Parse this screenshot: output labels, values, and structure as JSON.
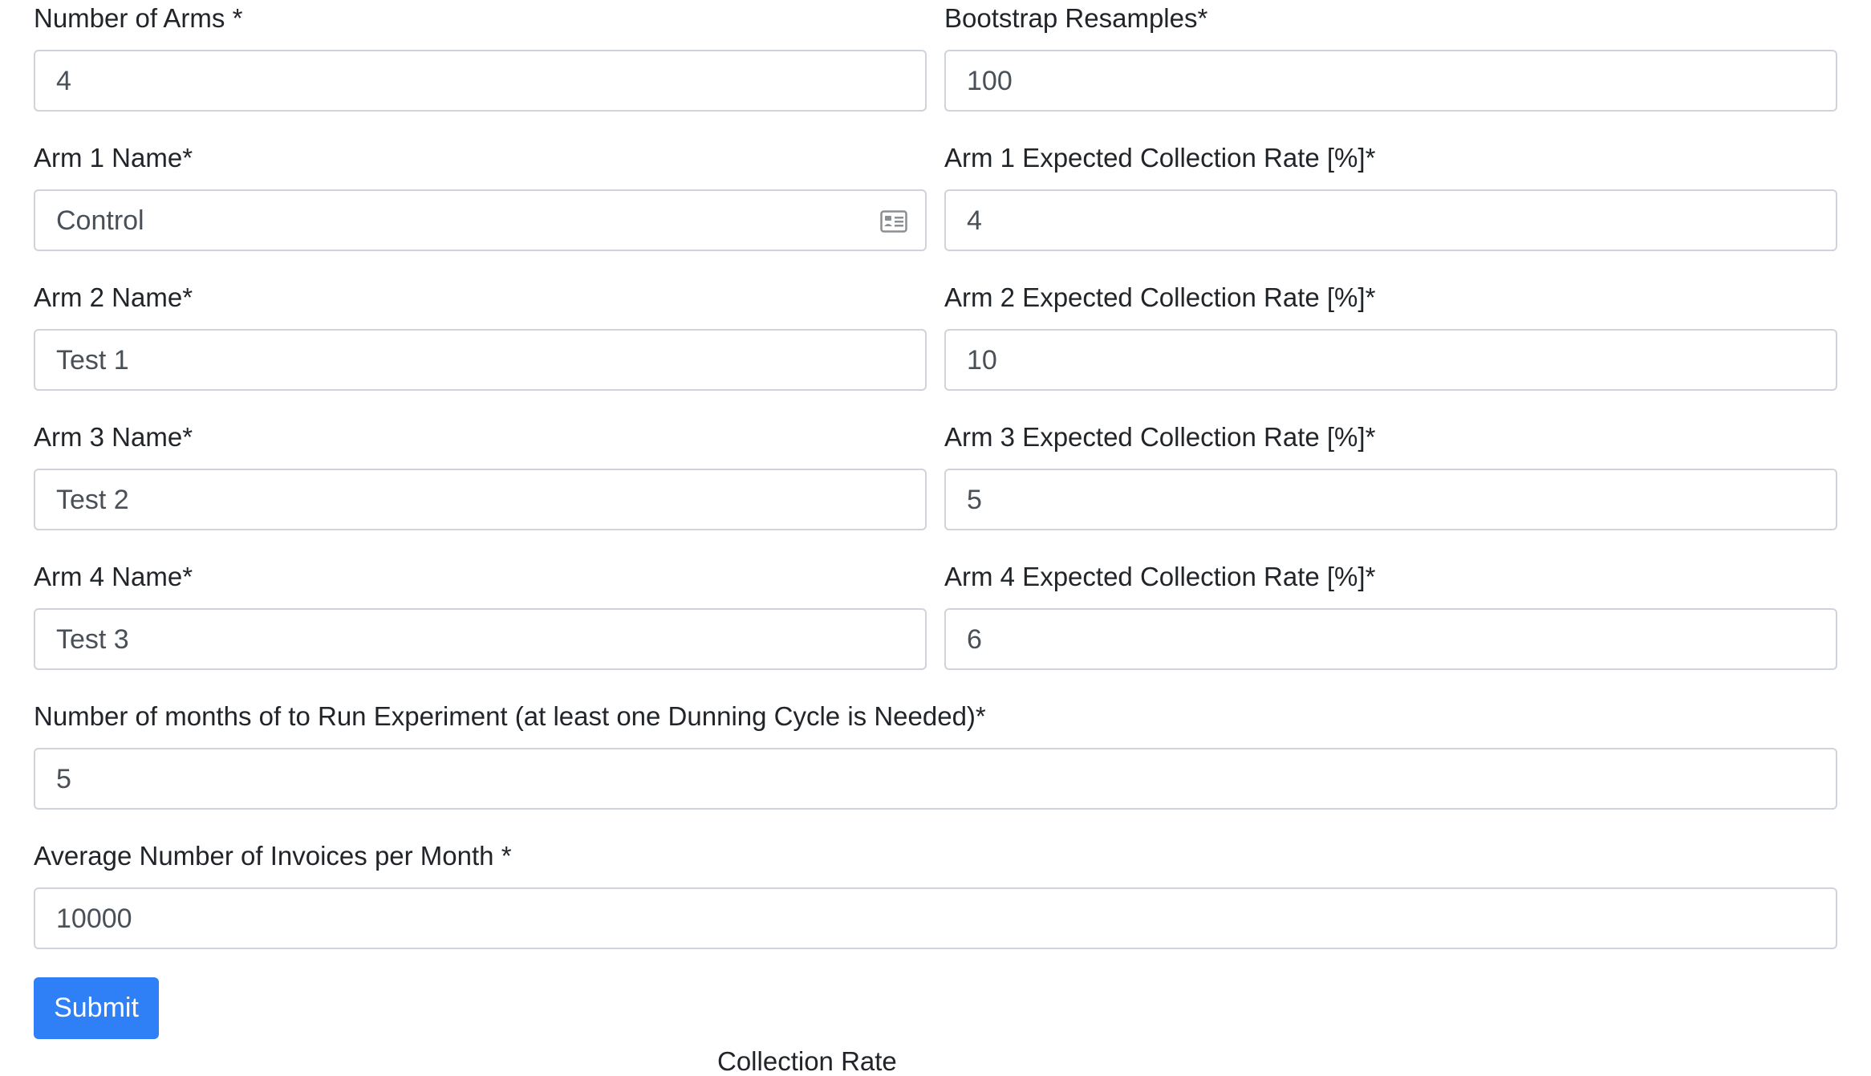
{
  "form": {
    "num_arms": {
      "label": "Number of Arms *",
      "value": "4"
    },
    "bootstrap": {
      "label": "Bootstrap Resamples*",
      "value": "100"
    },
    "arms": [
      {
        "name_label": "Arm 1 Name*",
        "name_value": "Control",
        "rate_label": "Arm 1 Expected Collection Rate [%]*",
        "rate_value": "4"
      },
      {
        "name_label": "Arm 2 Name*",
        "name_value": "Test 1",
        "rate_label": "Arm 2 Expected Collection Rate [%]*",
        "rate_value": "10"
      },
      {
        "name_label": "Arm 3 Name*",
        "name_value": "Test 2",
        "rate_label": "Arm 3 Expected Collection Rate [%]*",
        "rate_value": "5"
      },
      {
        "name_label": "Arm 4 Name*",
        "name_value": "Test 3",
        "rate_label": "Arm 4 Expected Collection Rate [%]*",
        "rate_value": "6"
      }
    ],
    "months": {
      "label": "Number of months of to Run Experiment (at least one Dunning Cycle is Needed)*",
      "value": "5"
    },
    "invoices": {
      "label": "Average Number of Invoices per Month *",
      "value": "10000"
    },
    "submit_label": "Submit",
    "autofill_icon": "contact-card-icon"
  },
  "below_fold_title": "Collection Rate",
  "colors": {
    "primary": "#2f7ff7",
    "border": "#ced4da",
    "text": "#212529",
    "input_text": "#495057"
  }
}
